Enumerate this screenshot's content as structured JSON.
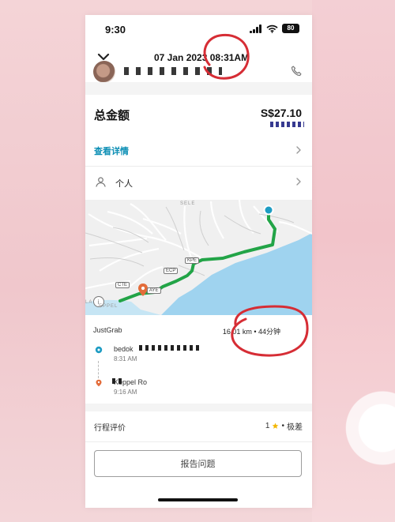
{
  "status_bar": {
    "time": "9:30",
    "battery": "80"
  },
  "header": {
    "date": "07 Jan 2023 08:31AM"
  },
  "fare": {
    "label": "总金额",
    "amount": "S$27.10",
    "details_link": "查看详情"
  },
  "profile": {
    "label": "个人"
  },
  "map": {
    "labels": {
      "cte": "CTE",
      "ecp": "ECP",
      "kpe": "KPE",
      "aye": "AYE",
      "top": "SELE",
      "bottom_left": "EPPEL",
      "left_edge": "LA"
    },
    "route_color": "#22a447",
    "sea_color": "#9fd3ef",
    "origin_color": "#1e9cc3",
    "destination_color": "#e36c3a"
  },
  "trip": {
    "service": "JustGrab",
    "summary": "16.01 km • 44分钟",
    "stops": [
      {
        "title": "bedok",
        "time": "8:31 AM"
      },
      {
        "title": "Keppel Ro",
        "time": "9:16 AM"
      }
    ]
  },
  "rating": {
    "label": "行程评价",
    "score": "1",
    "result": "极差"
  },
  "actions": {
    "report": "报告问题"
  }
}
